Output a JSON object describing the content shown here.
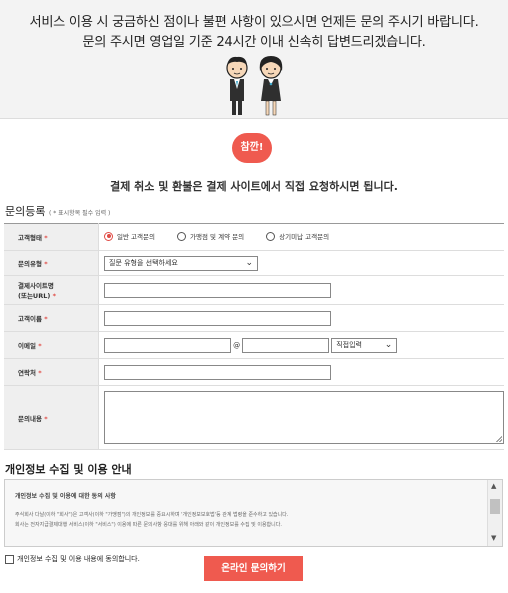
{
  "banner": {
    "line1": "서비스 이용 시 궁금하신 점이나 불편 사항이 있으시면 언제든 문의 주시기 바랍니다.",
    "line2": "문의 주시면 영업일 기준 24시간 이내 신속히 답변드리겠습니다."
  },
  "notice": {
    "badge": "참깐!",
    "text": "결제 취소 및 환불은 결제 사이트에서 직접 요청하시면 됩니다."
  },
  "form": {
    "title": "문의등록",
    "note": "( * 표시항목 필수 입력 )",
    "required_mark": "*",
    "customer_type": {
      "label": "고객형태",
      "options": [
        "일반 고객문의",
        "가맹점 및 계약 문의",
        "상기미납 고객문의"
      ],
      "selected": 0
    },
    "inquiry_type": {
      "label": "문의유형",
      "value": "질문 유형을 선택하세요"
    },
    "payment_site": {
      "label_1": "결제사이트명",
      "label_2": "(또는URL)"
    },
    "customer_name": {
      "label": "고객이름"
    },
    "email": {
      "label": "이메일",
      "at": "@",
      "domain_select": "직접입력"
    },
    "phone": {
      "label": "연락처"
    },
    "content": {
      "label": "문의내용"
    }
  },
  "privacy": {
    "title": "개인정보 수집 및 이용 안내",
    "box_title": "개인정보 수집 및 이용에 대한 동의 사항",
    "line1": "주식회사 다날(이하 \"회사\")은 고객사(이하 \"가맹점\")의 개인정보를 중요시하며 '개인정보보호법'등 관계 법령을 준수하고 있습니다.",
    "line2": "회사는 전자지급결제대행 서비스(이하 \"서비스\") 이용에 따른 문의사항 응대를 위해 아래와 같이 개인정보를 수집 및 이용합니다.",
    "agree_label": "개인정보 수집 및 이용 내용에 동의합니다."
  },
  "submit_label": "온라인 문의하기",
  "colors": {
    "accent": "#ef5a4f",
    "label_bg": "#efefef",
    "banner_bg": "#f3f3f3"
  }
}
